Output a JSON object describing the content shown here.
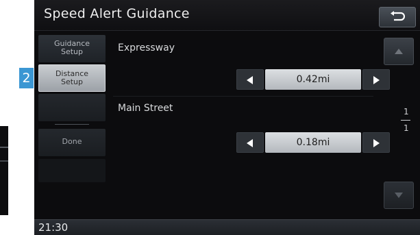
{
  "step_badge": "2",
  "header": {
    "title": "Speed Alert Guidance",
    "back_icon": "return-arrow-icon"
  },
  "menu": {
    "guidance_setup": {
      "line1": "Guidance",
      "line2": "Setup"
    },
    "distance_setup": {
      "line1": "Distance",
      "line2": "Setup",
      "selected": true
    },
    "done": "Done"
  },
  "settings": [
    {
      "label": "Expressway",
      "value": "0.42mi"
    },
    {
      "label": "Main Street",
      "value": "0.18mi"
    }
  ],
  "pager": {
    "current": "1",
    "total": "1"
  },
  "status": {
    "clock": "21:30"
  },
  "colors": {
    "badge": "#3b97d3",
    "screen_bg": "#0c0c0e",
    "selected_button": "#b4b8bd"
  }
}
